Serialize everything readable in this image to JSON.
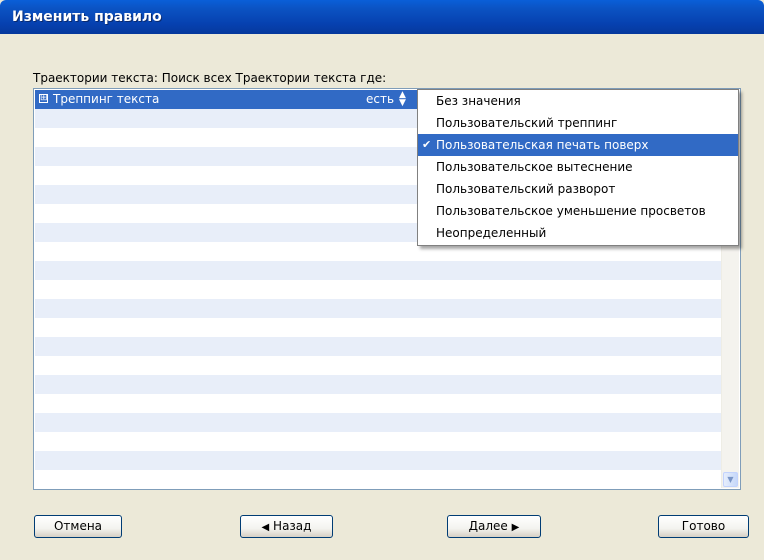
{
  "window": {
    "title": "Изменить правило"
  },
  "rule": {
    "prompt": "Траектории текста: Поиск всех Траектории текста где:",
    "selected_row": {
      "expander": "⊞",
      "field": "Треппинг текста",
      "operator": "есть",
      "operator_icon": "up-down-stepper-icon"
    }
  },
  "dropdown": {
    "items": [
      "Без значения",
      "Пользовательский треппинг",
      "Пользовательская печать поверх",
      "Пользовательское вытеснение",
      "Пользовательский разворот",
      "Пользовательское уменьшение просветов",
      "Неопределенный"
    ],
    "selected_item": "Пользовательская печать поверх",
    "check_glyph": "✔"
  },
  "buttons": {
    "cancel": "Отмена",
    "back": "Назад",
    "next": "Далее",
    "done": "Готово"
  },
  "colors": {
    "titlebar": "#0b53c3",
    "selection": "#316ac5",
    "row_stripe": "#e8eef9",
    "dialog_bg": "#ece9d8"
  }
}
